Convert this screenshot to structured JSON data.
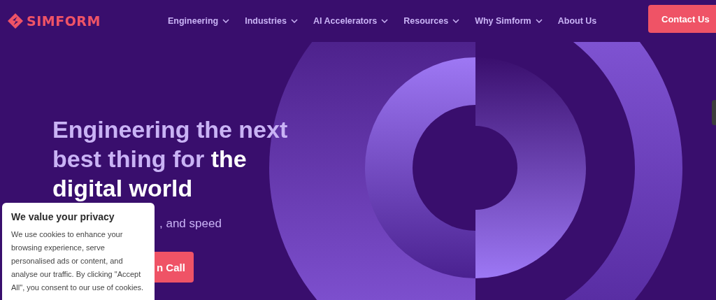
{
  "header": {
    "logo": "SIMFORM",
    "nav": [
      {
        "label": "Engineering",
        "dropdown": true
      },
      {
        "label": "Industries",
        "dropdown": true
      },
      {
        "label": "AI Accelerators",
        "dropdown": true
      },
      {
        "label": "Resources",
        "dropdown": true
      },
      {
        "label": "Why Simform",
        "dropdown": true
      },
      {
        "label": "About Us",
        "dropdown": false
      }
    ],
    "cta": "Contact Us"
  },
  "hero": {
    "headline": [
      [
        {
          "text": "Engineering the next",
          "emphasis": false
        }
      ],
      [
        {
          "text": "best thing for ",
          "emphasis": false
        },
        {
          "text": "the",
          "emphasis": true
        }
      ],
      [
        {
          "text": "digital world",
          "emphasis": true
        }
      ]
    ],
    "subtitle": ", and speed",
    "button": "n Call"
  },
  "cookie_banner": {
    "title": "We value your privacy",
    "body": "We use cookies to enhance your browsing experience, serve personalised ads or content, and analyse our traffic. By clicking \"Accept All\", you consent to our use of cookies."
  }
}
